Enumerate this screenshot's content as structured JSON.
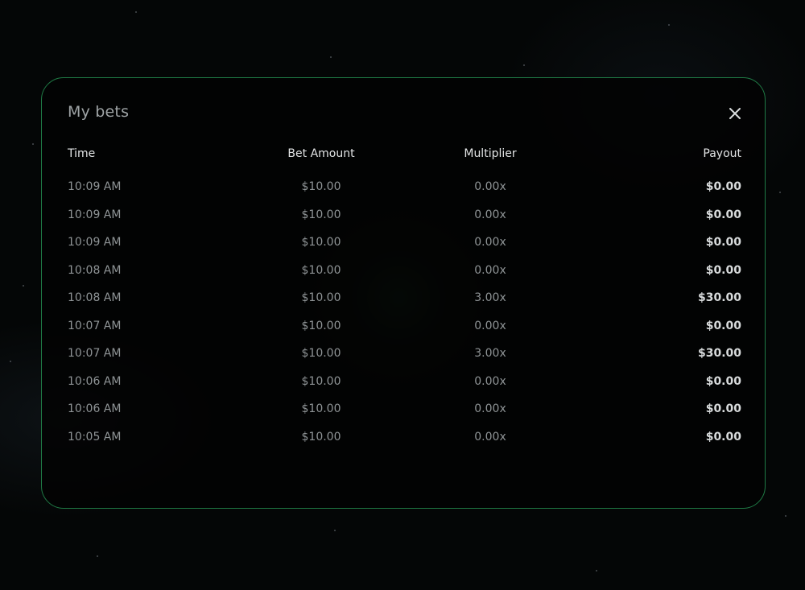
{
  "modal": {
    "title": "My bets",
    "close_icon": "close-icon"
  },
  "table": {
    "headers": {
      "time": "Time",
      "bet_amount": "Bet Amount",
      "multiplier": "Multiplier",
      "payout": "Payout"
    },
    "rows": [
      {
        "time": "10:09 AM",
        "bet_amount": "$10.00",
        "multiplier": "0.00x",
        "payout": "$0.00"
      },
      {
        "time": "10:09 AM",
        "bet_amount": "$10.00",
        "multiplier": "0.00x",
        "payout": "$0.00"
      },
      {
        "time": "10:09 AM",
        "bet_amount": "$10.00",
        "multiplier": "0.00x",
        "payout": "$0.00"
      },
      {
        "time": "10:08 AM",
        "bet_amount": "$10.00",
        "multiplier": "0.00x",
        "payout": "$0.00"
      },
      {
        "time": "10:08 AM",
        "bet_amount": "$10.00",
        "multiplier": "3.00x",
        "payout": "$30.00"
      },
      {
        "time": "10:07 AM",
        "bet_amount": "$10.00",
        "multiplier": "0.00x",
        "payout": "$0.00"
      },
      {
        "time": "10:07 AM",
        "bet_amount": "$10.00",
        "multiplier": "3.00x",
        "payout": "$30.00"
      },
      {
        "time": "10:06 AM",
        "bet_amount": "$10.00",
        "multiplier": "0.00x",
        "payout": "$0.00"
      },
      {
        "time": "10:06 AM",
        "bet_amount": "$10.00",
        "multiplier": "0.00x",
        "payout": "$0.00"
      },
      {
        "time": "10:05 AM",
        "bet_amount": "$10.00",
        "multiplier": "0.00x",
        "payout": "$0.00"
      }
    ]
  },
  "colors": {
    "modal_border": "#1f7a45",
    "background": "#040606",
    "header_text": "#e2e4e5",
    "cell_text": "#8f9496",
    "payout_text": "#d8dbdc"
  }
}
